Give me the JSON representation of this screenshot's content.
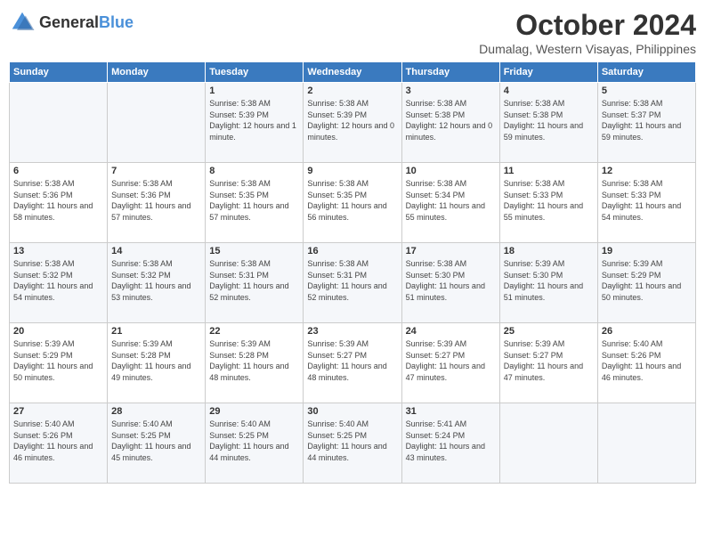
{
  "header": {
    "logo": {
      "general": "General",
      "blue": "Blue"
    },
    "title": "October 2024",
    "location": "Dumalag, Western Visayas, Philippines"
  },
  "days_of_week": [
    "Sunday",
    "Monday",
    "Tuesday",
    "Wednesday",
    "Thursday",
    "Friday",
    "Saturday"
  ],
  "weeks": [
    [
      {
        "day": "",
        "content": ""
      },
      {
        "day": "",
        "content": ""
      },
      {
        "day": "1",
        "content": "Sunrise: 5:38 AM\nSunset: 5:39 PM\nDaylight: 12 hours and 1 minute."
      },
      {
        "day": "2",
        "content": "Sunrise: 5:38 AM\nSunset: 5:39 PM\nDaylight: 12 hours and 0 minutes."
      },
      {
        "day": "3",
        "content": "Sunrise: 5:38 AM\nSunset: 5:38 PM\nDaylight: 12 hours and 0 minutes."
      },
      {
        "day": "4",
        "content": "Sunrise: 5:38 AM\nSunset: 5:38 PM\nDaylight: 11 hours and 59 minutes."
      },
      {
        "day": "5",
        "content": "Sunrise: 5:38 AM\nSunset: 5:37 PM\nDaylight: 11 hours and 59 minutes."
      }
    ],
    [
      {
        "day": "6",
        "content": "Sunrise: 5:38 AM\nSunset: 5:36 PM\nDaylight: 11 hours and 58 minutes."
      },
      {
        "day": "7",
        "content": "Sunrise: 5:38 AM\nSunset: 5:36 PM\nDaylight: 11 hours and 57 minutes."
      },
      {
        "day": "8",
        "content": "Sunrise: 5:38 AM\nSunset: 5:35 PM\nDaylight: 11 hours and 57 minutes."
      },
      {
        "day": "9",
        "content": "Sunrise: 5:38 AM\nSunset: 5:35 PM\nDaylight: 11 hours and 56 minutes."
      },
      {
        "day": "10",
        "content": "Sunrise: 5:38 AM\nSunset: 5:34 PM\nDaylight: 11 hours and 55 minutes."
      },
      {
        "day": "11",
        "content": "Sunrise: 5:38 AM\nSunset: 5:33 PM\nDaylight: 11 hours and 55 minutes."
      },
      {
        "day": "12",
        "content": "Sunrise: 5:38 AM\nSunset: 5:33 PM\nDaylight: 11 hours and 54 minutes."
      }
    ],
    [
      {
        "day": "13",
        "content": "Sunrise: 5:38 AM\nSunset: 5:32 PM\nDaylight: 11 hours and 54 minutes."
      },
      {
        "day": "14",
        "content": "Sunrise: 5:38 AM\nSunset: 5:32 PM\nDaylight: 11 hours and 53 minutes."
      },
      {
        "day": "15",
        "content": "Sunrise: 5:38 AM\nSunset: 5:31 PM\nDaylight: 11 hours and 52 minutes."
      },
      {
        "day": "16",
        "content": "Sunrise: 5:38 AM\nSunset: 5:31 PM\nDaylight: 11 hours and 52 minutes."
      },
      {
        "day": "17",
        "content": "Sunrise: 5:38 AM\nSunset: 5:30 PM\nDaylight: 11 hours and 51 minutes."
      },
      {
        "day": "18",
        "content": "Sunrise: 5:39 AM\nSunset: 5:30 PM\nDaylight: 11 hours and 51 minutes."
      },
      {
        "day": "19",
        "content": "Sunrise: 5:39 AM\nSunset: 5:29 PM\nDaylight: 11 hours and 50 minutes."
      }
    ],
    [
      {
        "day": "20",
        "content": "Sunrise: 5:39 AM\nSunset: 5:29 PM\nDaylight: 11 hours and 50 minutes."
      },
      {
        "day": "21",
        "content": "Sunrise: 5:39 AM\nSunset: 5:28 PM\nDaylight: 11 hours and 49 minutes."
      },
      {
        "day": "22",
        "content": "Sunrise: 5:39 AM\nSunset: 5:28 PM\nDaylight: 11 hours and 48 minutes."
      },
      {
        "day": "23",
        "content": "Sunrise: 5:39 AM\nSunset: 5:27 PM\nDaylight: 11 hours and 48 minutes."
      },
      {
        "day": "24",
        "content": "Sunrise: 5:39 AM\nSunset: 5:27 PM\nDaylight: 11 hours and 47 minutes."
      },
      {
        "day": "25",
        "content": "Sunrise: 5:39 AM\nSunset: 5:27 PM\nDaylight: 11 hours and 47 minutes."
      },
      {
        "day": "26",
        "content": "Sunrise: 5:40 AM\nSunset: 5:26 PM\nDaylight: 11 hours and 46 minutes."
      }
    ],
    [
      {
        "day": "27",
        "content": "Sunrise: 5:40 AM\nSunset: 5:26 PM\nDaylight: 11 hours and 46 minutes."
      },
      {
        "day": "28",
        "content": "Sunrise: 5:40 AM\nSunset: 5:25 PM\nDaylight: 11 hours and 45 minutes."
      },
      {
        "day": "29",
        "content": "Sunrise: 5:40 AM\nSunset: 5:25 PM\nDaylight: 11 hours and 44 minutes."
      },
      {
        "day": "30",
        "content": "Sunrise: 5:40 AM\nSunset: 5:25 PM\nDaylight: 11 hours and 44 minutes."
      },
      {
        "day": "31",
        "content": "Sunrise: 5:41 AM\nSunset: 5:24 PM\nDaylight: 11 hours and 43 minutes."
      },
      {
        "day": "",
        "content": ""
      },
      {
        "day": "",
        "content": ""
      }
    ]
  ]
}
